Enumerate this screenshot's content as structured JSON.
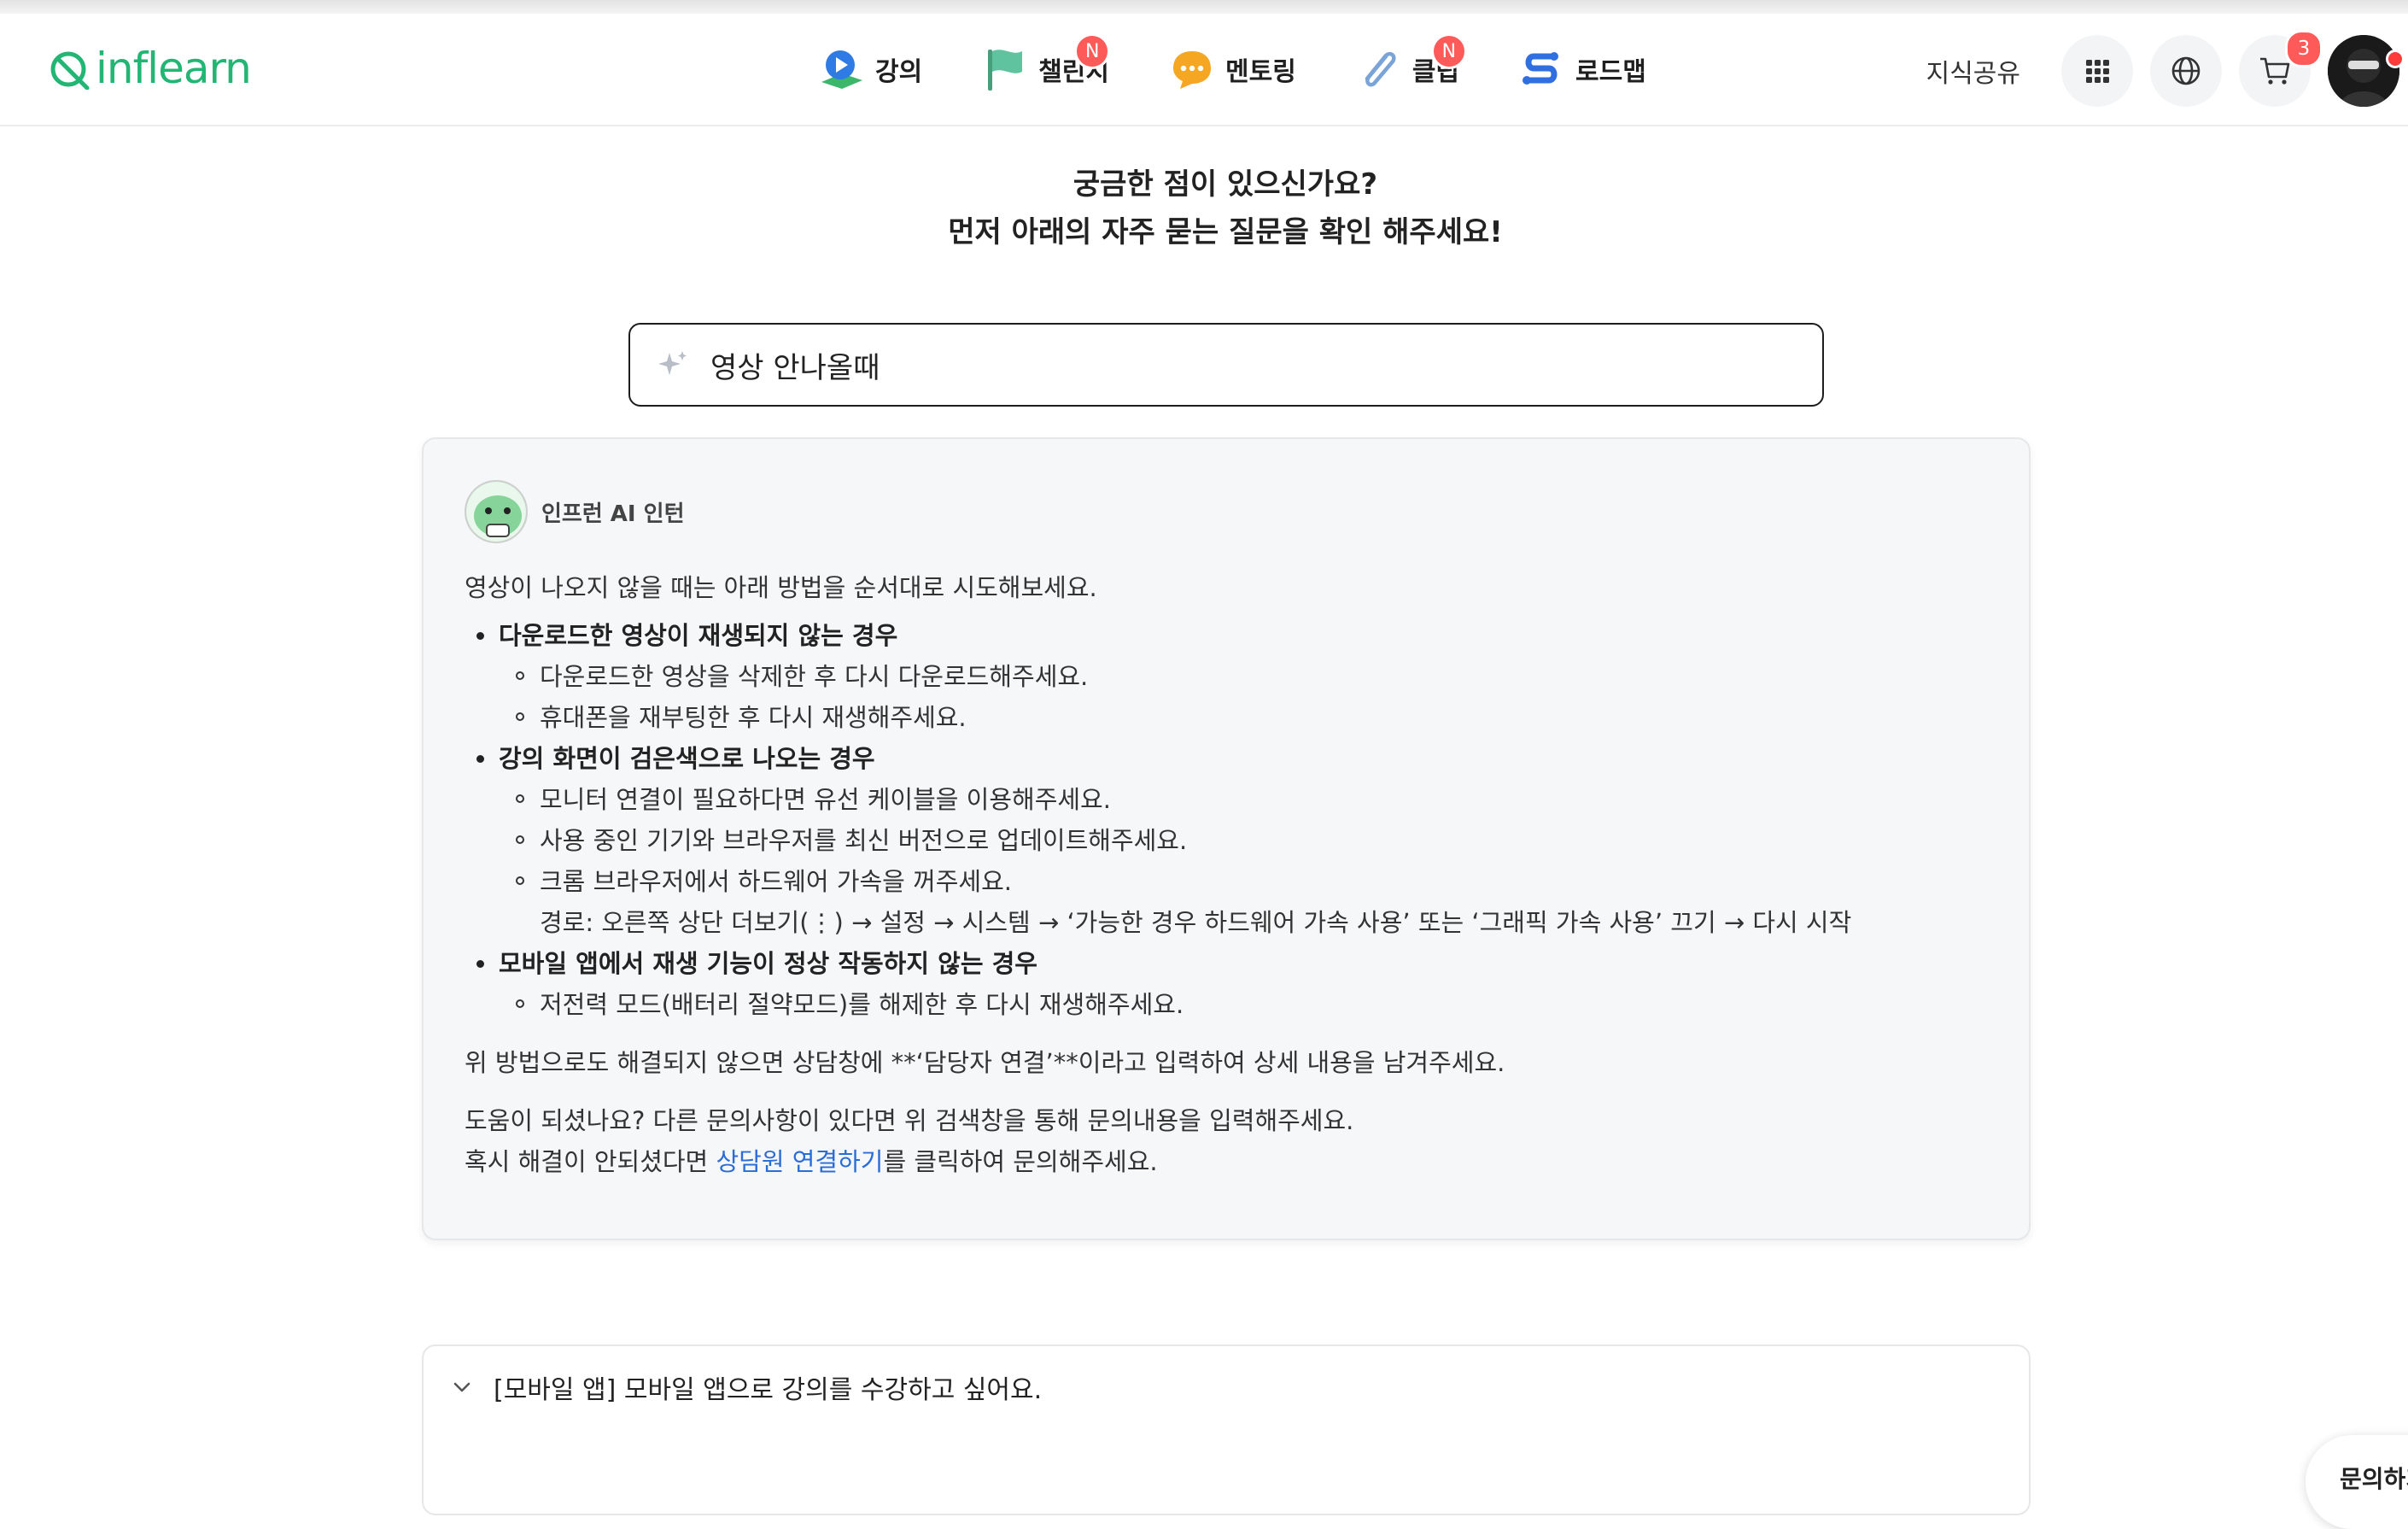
{
  "header": {
    "logo": "inflearn",
    "nav": [
      {
        "label": "강의",
        "icon": "lecture-play-icon",
        "badge": ""
      },
      {
        "label": "챌린지",
        "icon": "challenge-flag-icon",
        "badge": "N"
      },
      {
        "label": "멘토링",
        "icon": "mentoring-chat-icon",
        "badge": ""
      },
      {
        "label": "클립",
        "icon": "clip-paperclip-icon",
        "badge": "N"
      },
      {
        "label": "로드맵",
        "icon": "roadmap-icon",
        "badge": ""
      }
    ],
    "share_label": "지식공유",
    "cart_count": "3"
  },
  "intro": {
    "line1": "궁금한 점이 있으신가요?",
    "line2": "먼저 아래의 자주 묻는 질문을 확인 해주세요!"
  },
  "search": {
    "value": "영상 안나올때"
  },
  "answer": {
    "bot_name": "인프런 AI 인턴",
    "intro": "영상이 나오지 않을 때는 아래 방법을 순서대로 시도해보세요.",
    "sections": [
      {
        "title": "다운로드한 영상이 재생되지 않는 경우",
        "items": [
          "다운로드한 영상을 삭제한 후 다시 다운로드해주세요.",
          "휴대폰을 재부팅한 후 다시 재생해주세요."
        ]
      },
      {
        "title": "강의 화면이 검은색으로 나오는 경우",
        "items": [
          "모니터 연결이 필요하다면 유선 케이블을 이용해주세요.",
          "사용 중인 기기와 브라우저를 최신 버전으로 업데이트해주세요.",
          "크롬 브라우저에서 하드웨어 가속을 꺼주세요."
        ],
        "path": "경로: 오른쪽 상단 더보기(⋮) → 설정 → 시스템 → ‘가능한 경우 하드웨어 가속 사용’ 또는 ‘그래픽 가속 사용’ 끄기 → 다시 시작"
      },
      {
        "title": "모바일 앱에서 재생 기능이 정상 작동하지 않는 경우",
        "items": [
          "저전력 모드(배터리 절약모드)를 해제한 후 다시 재생해주세요."
        ]
      }
    ],
    "fallback": "위 방법으로도 해결되지 않으면 상담창에 **‘담당자 연결’**이라고 입력하여 상세 내용을 남겨주세요.",
    "help_line": "도움이 되셨나요? 다른 문의사항이 있다면 위 검색창을 통해 문의내용을 입력해주세요.",
    "contact_prefix": "혹시 해결이 안되셨다면 ",
    "contact_link": "상담원 연결하기",
    "contact_suffix": "를 클릭하여 문의해주세요."
  },
  "faq": {
    "question": "[모바일 앱] 모바일 앱으로 강의를 수강하고 싶어요."
  },
  "floating": {
    "label": "문의하기"
  },
  "colors": {
    "brand": "#22b573",
    "link": "#2a6dd6",
    "badge": "#ff5a5a"
  }
}
